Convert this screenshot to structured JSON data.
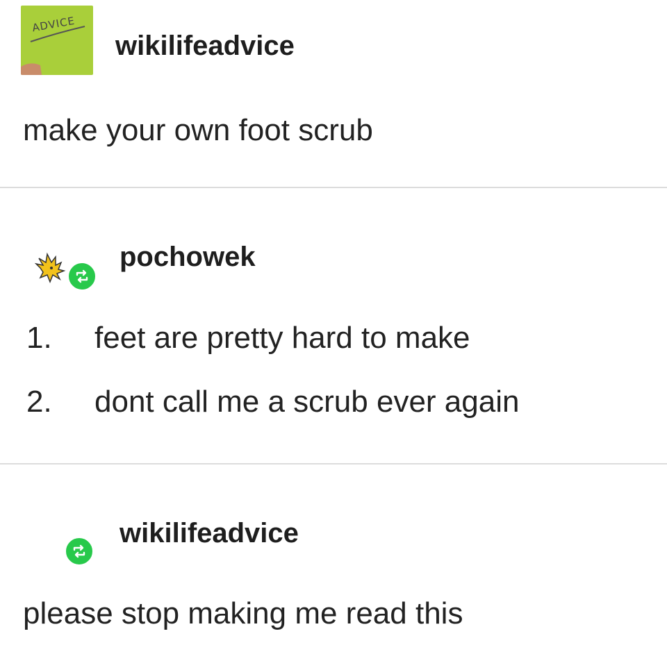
{
  "posts": [
    {
      "username": "wikilifeadvice",
      "avatar_label": "ADVICE",
      "body": "make your own foot scrub"
    },
    {
      "username": "pochowek",
      "list": [
        {
          "number": "1.",
          "text": "feet are pretty hard to make"
        },
        {
          "number": "2.",
          "text": "dont call me a scrub ever again"
        }
      ]
    },
    {
      "username": "wikilifeadvice",
      "body": "please stop making me read this"
    }
  ],
  "icons": {
    "reblog": "reblog-icon",
    "avatar_advice": "advice-note-avatar",
    "avatar_pochowek": "bird-avatar"
  },
  "colors": {
    "reblog_green": "#28c94b",
    "advice_avatar": "#a9cf3a",
    "divider": "#dcdcdc"
  }
}
